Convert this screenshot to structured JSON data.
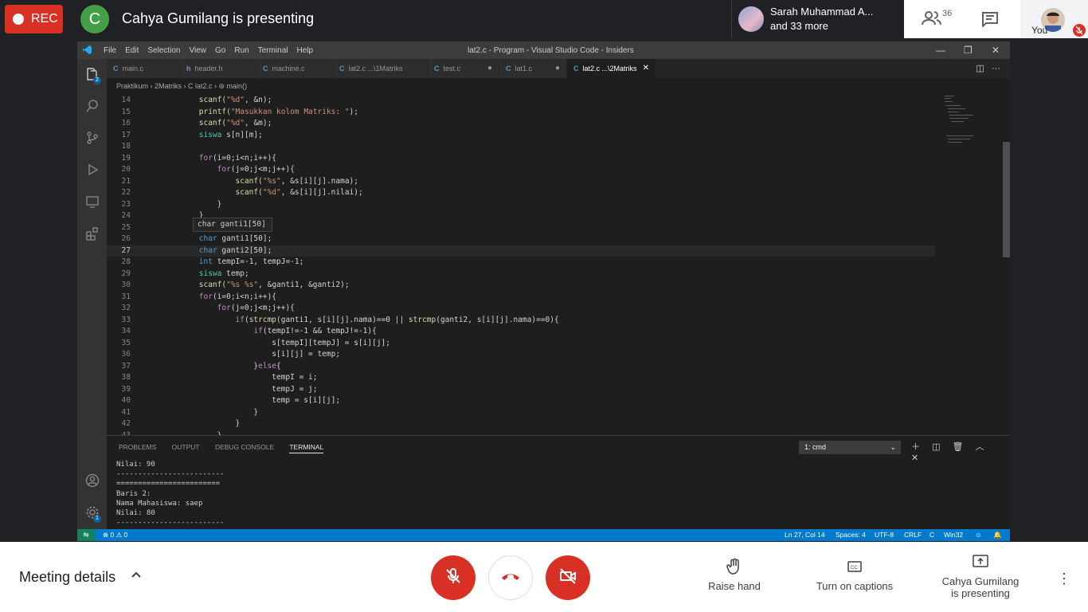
{
  "meet_top": {
    "rec_label": "REC",
    "presenter_initial": "C",
    "presenting_title": "Cahya Gumilang is presenting",
    "participants_name": "Sarah Muhammad A...",
    "participants_more": "and 33 more",
    "people_count": "36",
    "you_label": "You"
  },
  "vscode": {
    "menu": [
      "File",
      "Edit",
      "Selection",
      "View",
      "Go",
      "Run",
      "Terminal",
      "Help"
    ],
    "window_title": "lat2.c - Program - Visual Studio Code - Insiders",
    "tabs": [
      {
        "label": "main.c",
        "icon": "C"
      },
      {
        "label": "header.h",
        "icon": "h"
      },
      {
        "label": "machine.c",
        "icon": "C"
      },
      {
        "label": "lat2.c ...\\1Matriks",
        "icon": "C"
      },
      {
        "label": "test.c",
        "icon": "C"
      },
      {
        "label": "lat1.c",
        "icon": "C"
      },
      {
        "label": "lat2.c ...\\2Matriks",
        "icon": "C"
      }
    ],
    "breadcrumb": "Praktikum  ›  2Matriks  ›  C  lat2.c  ›  ⊛ main()",
    "activity_badges": {
      "explorer": "2",
      "settings": "1"
    },
    "hover_tip": "char ganti1[50]",
    "code_lines": [
      {
        "n": "14",
        "t": "        scanf(\"%d\", &n);"
      },
      {
        "n": "15",
        "t": "        printf(\"Masukkan kolom Matriks: \");"
      },
      {
        "n": "16",
        "t": "        scanf(\"%d\", &m);"
      },
      {
        "n": "17",
        "t": "        siswa s[n][m];"
      },
      {
        "n": "18",
        "t": ""
      },
      {
        "n": "19",
        "t": "        for(i=0;i<n;i++){"
      },
      {
        "n": "20",
        "t": "            for(j=0;j<m;j++){"
      },
      {
        "n": "21",
        "t": "                scanf(\"%s\", &s[i][j].nama);"
      },
      {
        "n": "22",
        "t": "                scanf(\"%d\", &s[i][j].nilai);"
      },
      {
        "n": "23",
        "t": "            }"
      },
      {
        "n": "24",
        "t": "        }"
      },
      {
        "n": "25",
        "t": ""
      },
      {
        "n": "26",
        "t": "        char ganti1[50];"
      },
      {
        "n": "27",
        "t": "        char ganti2[50];"
      },
      {
        "n": "28",
        "t": "        int tempI=-1, tempJ=-1;"
      },
      {
        "n": "29",
        "t": "        siswa temp;"
      },
      {
        "n": "30",
        "t": "        scanf(\"%s %s\", &ganti1, &ganti2);"
      },
      {
        "n": "31",
        "t": "        for(i=0;i<n;i++){"
      },
      {
        "n": "32",
        "t": "            for(j=0;j<m;j++){"
      },
      {
        "n": "33",
        "t": "                if(strcmp(ganti1, s[i][j].nama)==0 || strcmp(ganti2, s[i][j].nama)==0){"
      },
      {
        "n": "34",
        "t": "                    if(tempI!=-1 && tempJ!=-1){"
      },
      {
        "n": "35",
        "t": "                        s[tempI][tempJ] = s[i][j];"
      },
      {
        "n": "36",
        "t": "                        s[i][j] = temp;"
      },
      {
        "n": "37",
        "t": "                    }else{"
      },
      {
        "n": "38",
        "t": "                        tempI = i;"
      },
      {
        "n": "39",
        "t": "                        tempJ = j;"
      },
      {
        "n": "40",
        "t": "                        temp = s[i][j];"
      },
      {
        "n": "41",
        "t": "                    }"
      },
      {
        "n": "42",
        "t": "                }"
      },
      {
        "n": "43",
        "t": "            }"
      }
    ],
    "panel_tabs": [
      "PROBLEMS",
      "OUTPUT",
      "DEBUG CONSOLE",
      "TERMINAL"
    ],
    "terminal_select": "1: cmd",
    "terminal_lines": [
      "Nilai: 90",
      "-------------------------",
      "========================",
      "Baris 2:",
      "Nama Mahasiswa: saep",
      "Nilai: 80",
      "-------------------------"
    ],
    "status": {
      "errors": "⊗ 0 ⚠ 0",
      "position": "Ln 27, Col 14",
      "spaces": "Spaces: 4",
      "encoding": "UTF-8",
      "eol": "CRLF",
      "language": "C",
      "platform": "Win32"
    }
  },
  "meet_bottom": {
    "meeting_details": "Meeting details",
    "raise_hand": "Raise hand",
    "captions": "Turn on captions",
    "presenting_line1": "Cahya Gumilang",
    "presenting_line2": "is presenting"
  },
  "colors": {
    "rec": "#d93025",
    "accent": "#007acc",
    "avatar": "#43a047"
  }
}
